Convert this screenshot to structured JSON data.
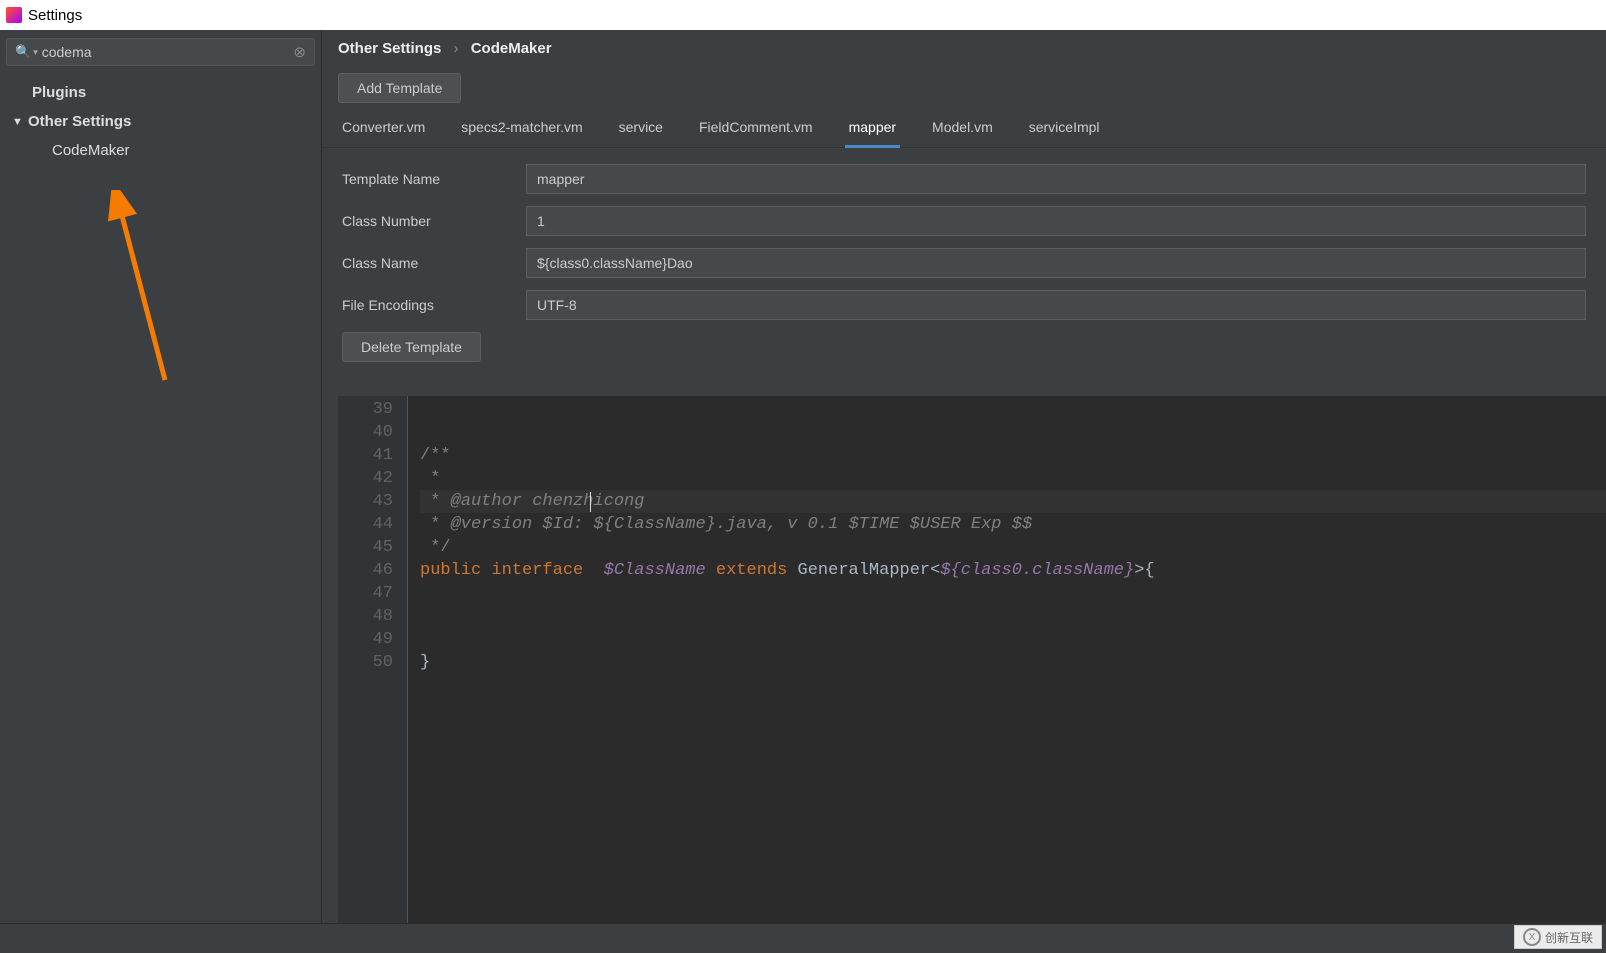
{
  "window": {
    "title": "Settings"
  },
  "search": {
    "value": "codema"
  },
  "sidebar": {
    "plugins": "Plugins",
    "otherSettings": "Other Settings",
    "codemaker": "CodeMaker"
  },
  "breadcrumb": {
    "a": "Other Settings",
    "b": "CodeMaker"
  },
  "buttons": {
    "addTemplate": "Add Template",
    "deleteTemplate": "Delete Template"
  },
  "tabs": [
    "Converter.vm",
    "specs2-matcher.vm",
    "service",
    "FieldComment.vm",
    "mapper",
    "Model.vm",
    "serviceImpl"
  ],
  "activeTab": "mapper",
  "form": {
    "templateNameLabel": "Template Name",
    "templateName": "mapper",
    "classNumberLabel": "Class Number",
    "classNumber": "1",
    "classNameLabel": "Class Name",
    "className": "${class0.className}Dao",
    "fileEncodingsLabel": "File Encodings",
    "fileEncodings": "UTF-8"
  },
  "editor": {
    "startLine": 39,
    "lines": [
      "",
      "",
      "/**",
      " *",
      " * @author chenzhicong",
      " * @version $Id: ${ClassName}.java, v 0.1 $TIME $USER Exp $$",
      " */",
      "public interface  $ClassName extends GeneralMapper<${class0.className}>{",
      "",
      "",
      "",
      "}"
    ]
  },
  "watermark": "创新互联"
}
